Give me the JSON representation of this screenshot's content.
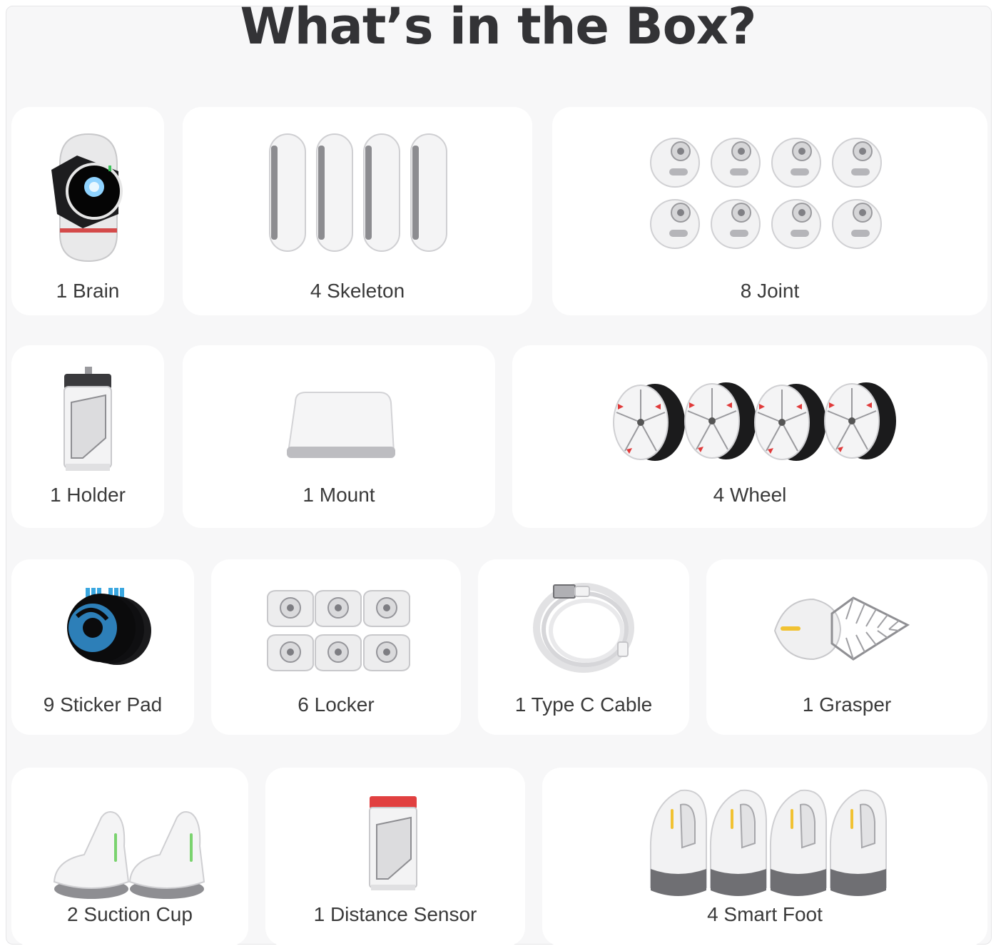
{
  "page": {
    "title": "What’s in the Box?"
  },
  "items": [
    {
      "id": "brain",
      "label": "1 Brain"
    },
    {
      "id": "skeleton",
      "label": "4 Skeleton"
    },
    {
      "id": "joint",
      "label": "8 Joint"
    },
    {
      "id": "holder",
      "label": "1 Holder"
    },
    {
      "id": "mount",
      "label": "1 Mount"
    },
    {
      "id": "wheel",
      "label": "4 Wheel"
    },
    {
      "id": "sticker-pad",
      "label": "9 Sticker Pad"
    },
    {
      "id": "locker",
      "label": "6 Locker"
    },
    {
      "id": "type-c-cable",
      "label": "1 Type C Cable"
    },
    {
      "id": "grasper",
      "label": "1 Grasper"
    },
    {
      "id": "suction-cup",
      "label": "2 Suction Cup"
    },
    {
      "id": "distance-sensor",
      "label": "1 Distance Sensor"
    },
    {
      "id": "smart-foot",
      "label": "4 Smart Foot"
    }
  ]
}
